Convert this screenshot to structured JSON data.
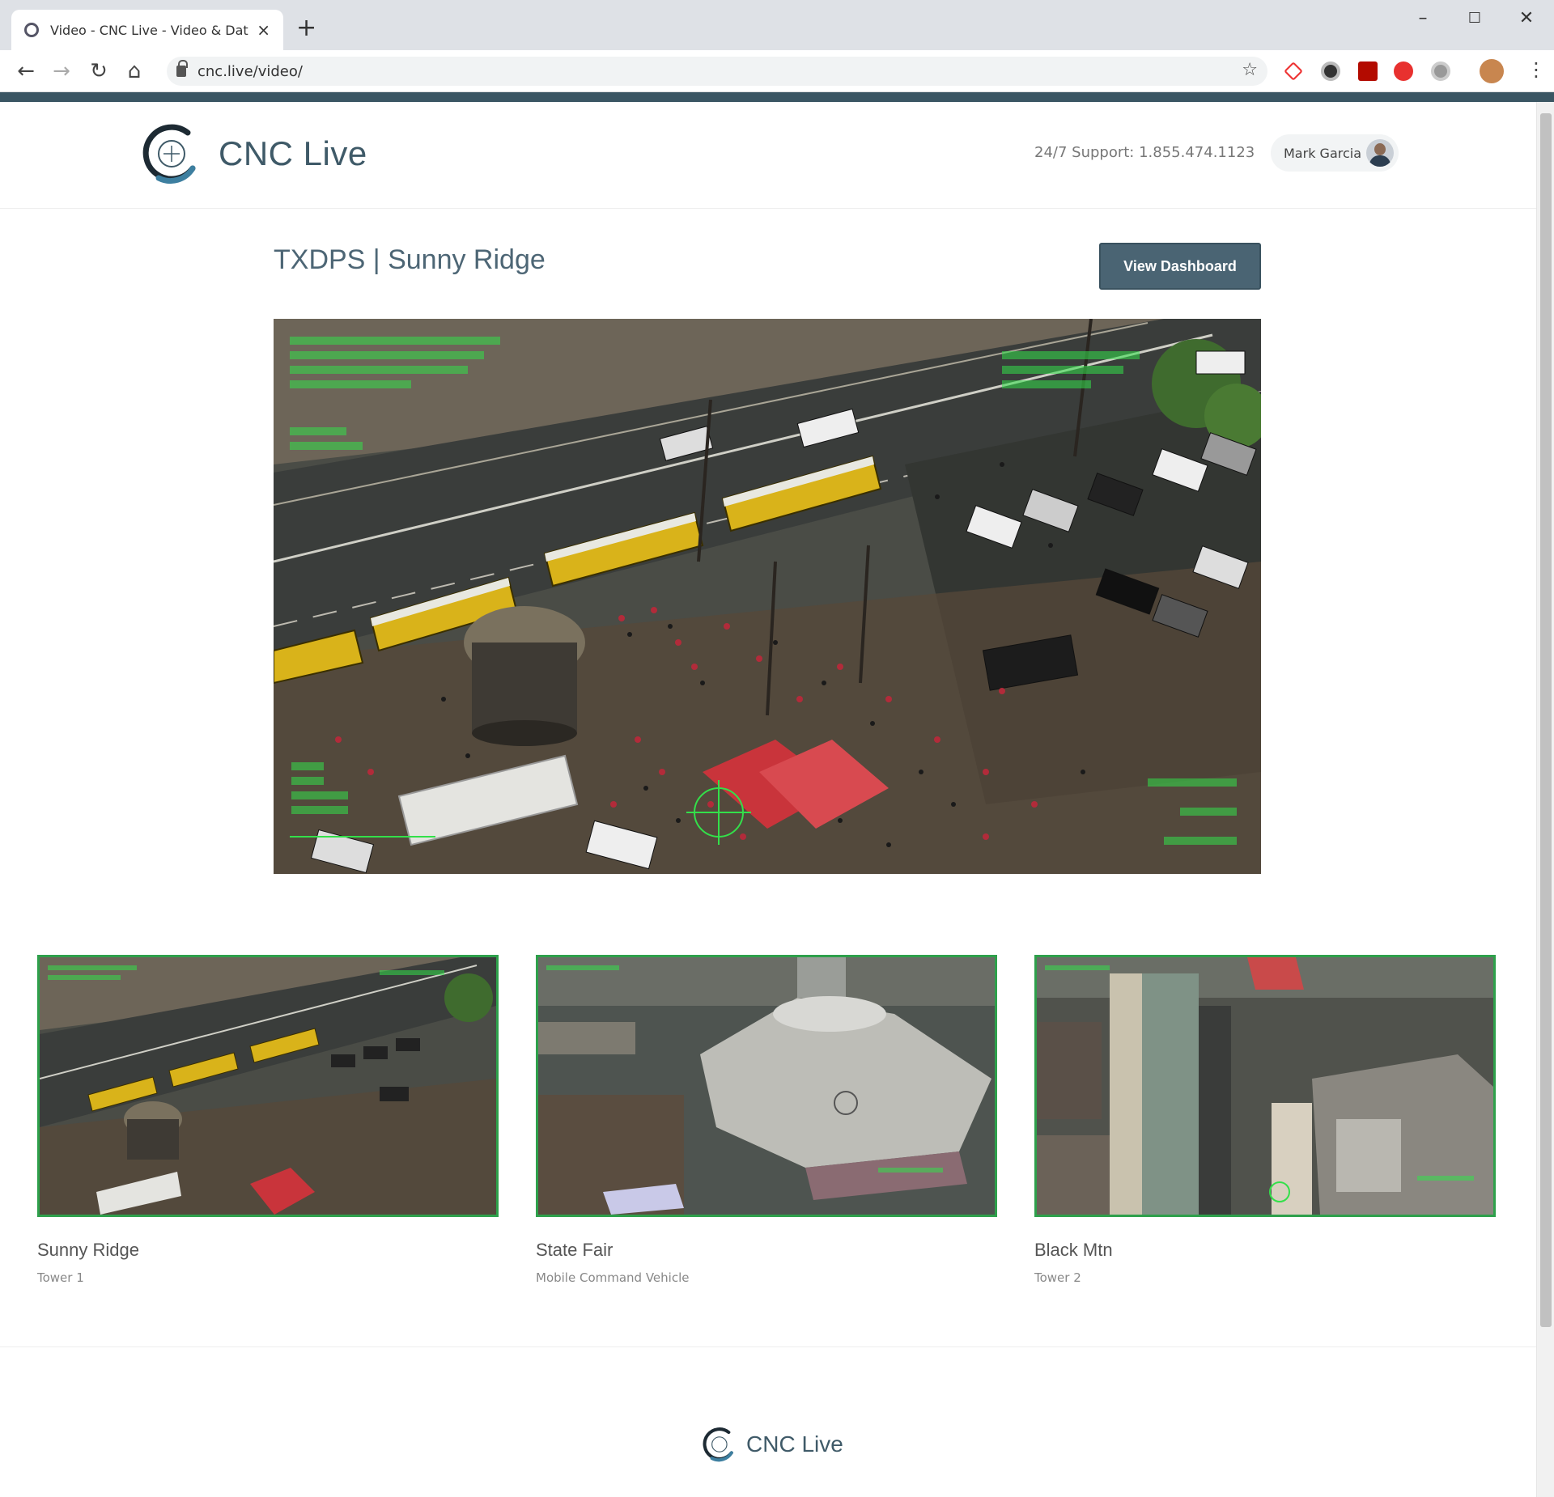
{
  "browser": {
    "tab_title": "Video - CNC Live - Video & Data",
    "url": "cnc.live/video/",
    "new_tab": "+",
    "tab_close": "×",
    "min": "–",
    "max": "☐",
    "close": "✕",
    "back": "←",
    "forward": "→",
    "reload": "↻",
    "home": "⌂",
    "bookmark": "☆",
    "menu": "⋮"
  },
  "header": {
    "brand": "CNC Live",
    "support": "24/7 Support: 1.855.474.1123",
    "user_name": "Mark Garcia"
  },
  "main": {
    "title": "TXDPS | Sunny Ridge",
    "dashboard_button": "View Dashboard"
  },
  "feeds": [
    {
      "title": "Sunny Ridge",
      "subtitle": "Tower 1"
    },
    {
      "title": "State Fair",
      "subtitle": "Mobile Command Vehicle"
    },
    {
      "title": "Black Mtn",
      "subtitle": "Tower 2"
    }
  ],
  "footer": {
    "brand": "CNC Live"
  },
  "colors": {
    "accent": "#3b5663",
    "button": "#4a6473",
    "feed_border": "#2ea04b",
    "hud_green": "#33e04a"
  },
  "icons": [
    "logo-icon",
    "lock-icon",
    "star-icon",
    "avatar",
    "menu-icon"
  ]
}
